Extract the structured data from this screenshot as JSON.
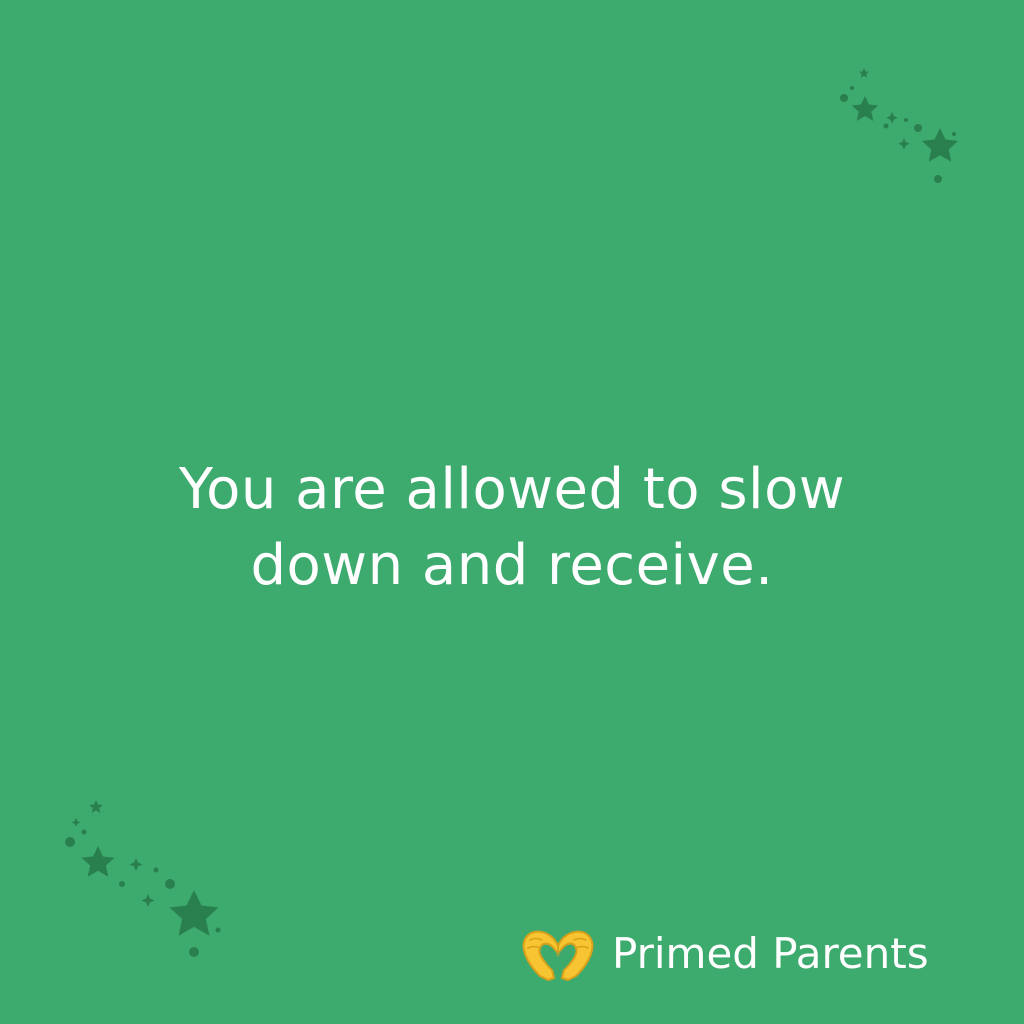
{
  "colors": {
    "background": "#3daa6e",
    "text": "#ffffff",
    "decoration": "#2a7f4f",
    "icon_fill": "#f7c531",
    "icon_outline": "#d9a11b"
  },
  "quote": {
    "line1": "You are allowed to slow",
    "line2": "down and receive."
  },
  "brand": {
    "icon": "heart-hands-icon",
    "name": "Primed Parents"
  },
  "decorations": [
    "star-cluster-icon",
    "star-cluster-icon"
  ]
}
